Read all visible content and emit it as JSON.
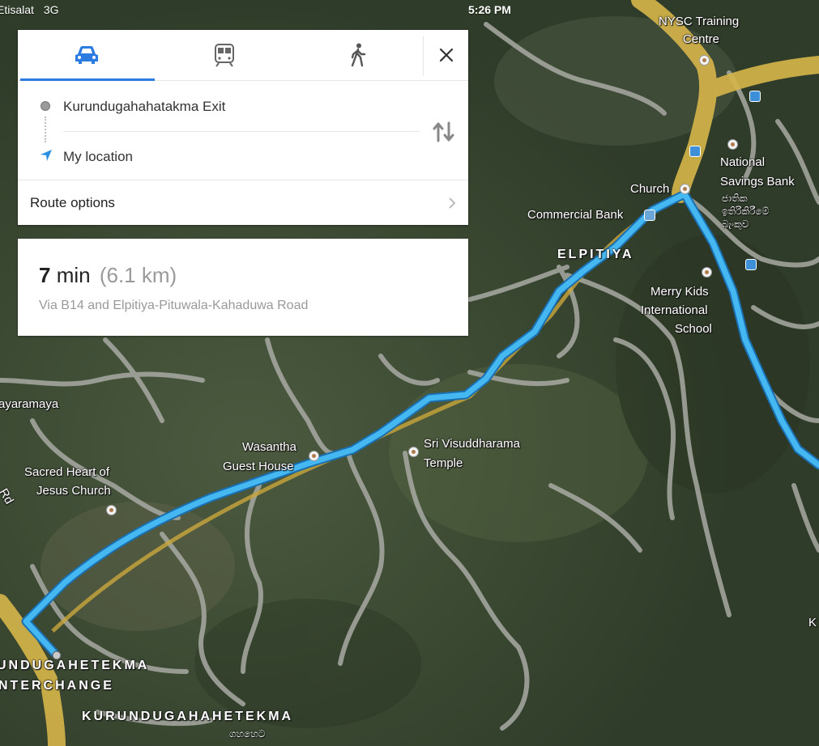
{
  "status_bar": {
    "carrier": "Etisalat",
    "network": "3G",
    "time": "5:26 PM"
  },
  "directions": {
    "tabs": [
      {
        "label": "Drive",
        "icon": "car-icon",
        "selected": true
      },
      {
        "label": "Transit",
        "icon": "train-icon",
        "selected": false
      },
      {
        "label": "Walk",
        "icon": "walking-person-icon",
        "selected": false
      }
    ],
    "close_icon": "close-icon",
    "from": "Kurundugahahatakma Exit",
    "to": "My location",
    "swap_icon": "swap-arrows-icon",
    "route_options_label": "Route options"
  },
  "route": {
    "duration_value": "7",
    "duration_unit": "min",
    "distance": "(6.1 km)",
    "via": "Via B14 and Elpitiya-Pituwala-Kahaduwa Road"
  },
  "map_labels": {
    "nysc_line1": "NYSC Training",
    "nysc_line2": "Centre",
    "church": "Church",
    "national_line1": "National",
    "national_line2": "Savings Bank",
    "sinhala_1": "ජාතික",
    "sinhala_2": "ඉතිරිකිරීමේ",
    "sinhala_3": "බැංකුව",
    "commercial_bank": "Commercial Bank",
    "elpitiya": "ELPITIYA",
    "merry_line1": "Merry Kids",
    "merry_line2": "International",
    "merry_line3": "School",
    "ayaramaya": "ayaramaya",
    "wasantha_line1": "Wasantha",
    "wasantha_line2": "Guest House",
    "sri_line1": "Sri Visuddharama",
    "sri_line2": "Temple",
    "sacred_line1": "Sacred Heart of",
    "sacred_line2": "Jesus Church",
    "rd": "Rd",
    "interchange_line1": "UNDUGAHETEKMA",
    "interchange_line2": "NTERCHANGE",
    "kurundugahetekma": "KURUNDUGAHAHETEKMA",
    "sinhala_bottom": "ගහහෙට",
    "edge_k": "K"
  },
  "colors": {
    "route": "#3fb2ef",
    "tab_accent": "#2b7be0",
    "highway": "#d7b64a"
  }
}
